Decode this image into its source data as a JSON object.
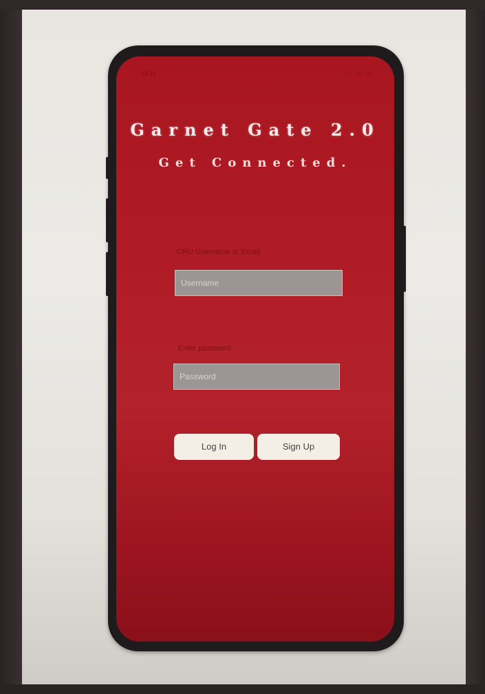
{
  "status_bar": {
    "time": "12:11",
    "icons": "..ıl ⌔ ▭"
  },
  "app": {
    "title": "Garnet Gate 2.0",
    "subtitle": "Get Connected."
  },
  "login_form": {
    "username_label": "CRU Username or Email",
    "username_placeholder": "Username",
    "password_label": "Enter password",
    "password_placeholder": "Password",
    "login_label": "Log In",
    "signup_label": "Sign Up"
  },
  "colors": {
    "app_red": "#b01c26",
    "button_cream": "#f4efe6",
    "field_gray": "#9b9593"
  }
}
